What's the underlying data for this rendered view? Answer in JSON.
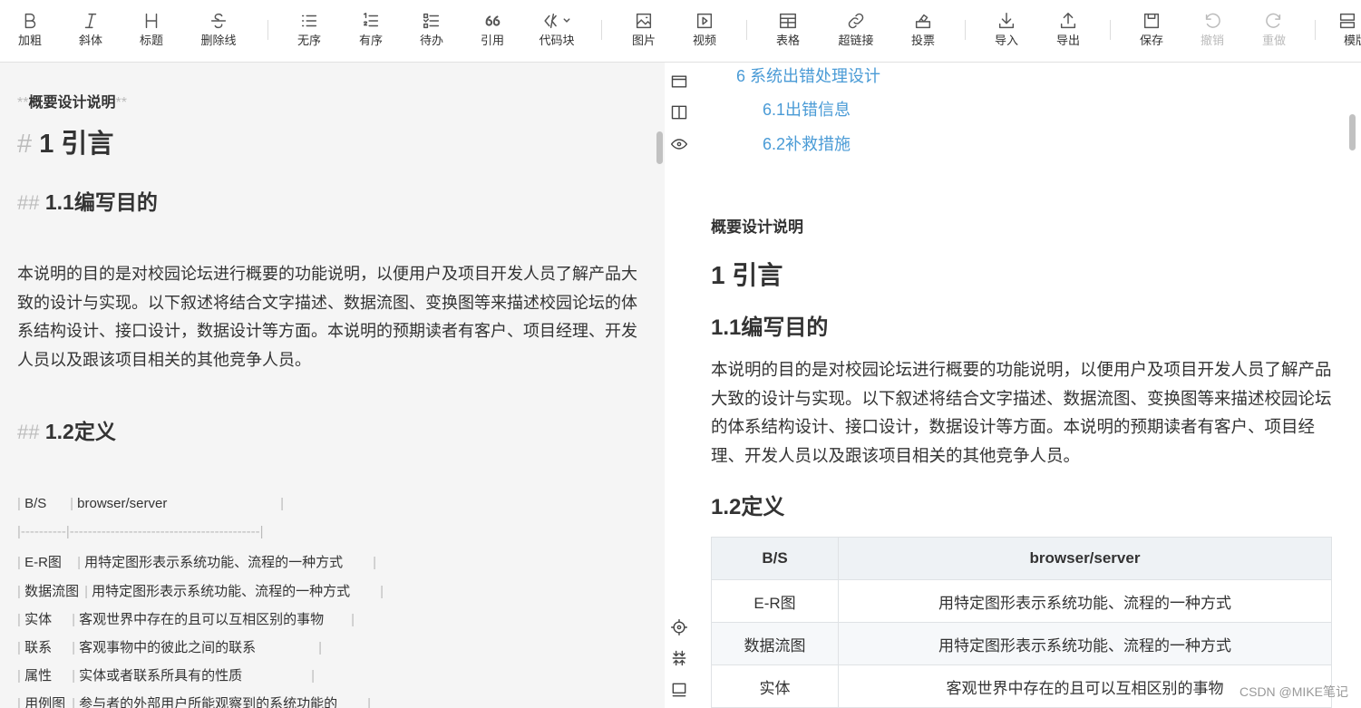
{
  "toolbar": {
    "items": [
      {
        "label": "加粗",
        "icon": "bold-icon"
      },
      {
        "label": "斜体",
        "icon": "italic-icon"
      },
      {
        "label": "标题",
        "icon": "heading-icon"
      },
      {
        "label": "删除线",
        "icon": "strikethrough-icon"
      },
      {
        "label": "无序",
        "icon": "unordered-list-icon"
      },
      {
        "label": "有序",
        "icon": "ordered-list-icon"
      },
      {
        "label": "待办",
        "icon": "todo-list-icon"
      },
      {
        "label": "引用",
        "icon": "quote-icon"
      },
      {
        "label": "代码块",
        "icon": "code-block-icon"
      },
      {
        "label": "图片",
        "icon": "image-icon"
      },
      {
        "label": "视频",
        "icon": "video-icon"
      },
      {
        "label": "表格",
        "icon": "table-icon"
      },
      {
        "label": "超链接",
        "icon": "link-icon"
      },
      {
        "label": "投票",
        "icon": "vote-icon"
      },
      {
        "label": "导入",
        "icon": "import-icon"
      },
      {
        "label": "导出",
        "icon": "export-icon"
      },
      {
        "label": "保存",
        "icon": "save-icon"
      },
      {
        "label": "撤销",
        "icon": "undo-icon",
        "disabled": true
      },
      {
        "label": "重做",
        "icon": "redo-icon",
        "disabled": true
      },
      {
        "label": "模版",
        "icon": "template-icon"
      }
    ]
  },
  "editor": {
    "bold_line": {
      "mark_open": "**",
      "text": "概要设计说明",
      "mark_close": "**"
    },
    "h1": {
      "mark": "#",
      "text": "1 引言"
    },
    "h2_1": {
      "mark": "##",
      "text": "1.1编写目的"
    },
    "paragraph": "本说明的目的是对校园论坛进行概要的功能说明，以便用户及项目开发人员了解产品大致的设计与实现。以下叙述将结合文字描述、数据流图、变换图等来描述校园论坛的体系结构设计、接口设计，数据设计等方面。本说明的预期读者有客户、项目经理、开发人员以及跟该项目相关的其他竞争人员。",
    "h2_2": {
      "mark": "##",
      "text": "1.2定义"
    },
    "table_rows": [
      {
        "term": "B/S",
        "desc": "browser/server"
      },
      {
        "term": "E-R图",
        "desc": "用特定图形表示系统功能、流程的一种方式"
      },
      {
        "term": "数据流图",
        "desc": "用特定图形表示系统功能、流程的一种方式"
      },
      {
        "term": "实体",
        "desc": "客观世界中存在的且可以互相区别的事物"
      },
      {
        "term": "联系",
        "desc": "客观事物中的彼此之间的联系"
      },
      {
        "term": "属性",
        "desc": "实体或者联系所具有的性质"
      },
      {
        "term": "用例图",
        "desc": "参与者的外部用户所能观察到的系统功能的"
      }
    ],
    "separator_dashes_1": "----------",
    "separator_dashes_2": "------------------------------------------"
  },
  "side_tools": {
    "top": [
      "editor-only-icon",
      "split-view-icon",
      "preview-eye-icon"
    ],
    "bottom": [
      "locate-icon",
      "sync-scroll-icon",
      "fullscreen-icon"
    ]
  },
  "preview": {
    "toc": [
      {
        "text": "6 系统出错处理设计"
      },
      {
        "text": "6.1出错信息"
      },
      {
        "text": "6.2补救措施"
      }
    ],
    "title": "概要设计说明",
    "h1": "1 引言",
    "h2_1": "1.1编写目的",
    "paragraph": "本说明的目的是对校园论坛进行概要的功能说明，以便用户及项目开发人员了解产品大致的设计与实现。以下叙述将结合文字描述、数据流图、变换图等来描述校园论坛的体系结构设计、接口设计，数据设计等方面。本说明的预期读者有客户、项目经理、开发人员以及跟该项目相关的其他竞争人员。",
    "h2_2": "1.2定义",
    "table": {
      "header": [
        "B/S",
        "browser/server"
      ],
      "rows": [
        [
          "E-R图",
          "用特定图形表示系统功能、流程的一种方式"
        ],
        [
          "数据流图",
          "用特定图形表示系统功能、流程的一种方式"
        ],
        [
          "实体",
          "客观世界中存在的且可以互相区别的事物"
        ]
      ]
    }
  },
  "watermark": "CSDN @MIKE笔记"
}
